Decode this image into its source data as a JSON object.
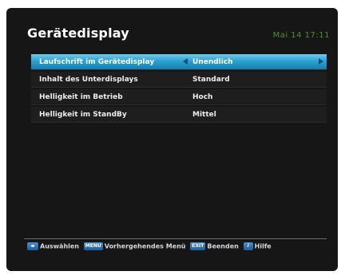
{
  "header": {
    "title": "Gerätedisplay",
    "clock": "Mai 14 17:11"
  },
  "menu": {
    "items": [
      {
        "label": "Laufschrift im Gerätedisplay",
        "value": "Unendlich"
      },
      {
        "label": "Inhalt des Unterdisplays",
        "value": "Standard"
      },
      {
        "label": "Helligkeit im Betrieb",
        "value": "Hoch"
      },
      {
        "label": "Helligkeit im StandBy",
        "value": "Mittel"
      }
    ]
  },
  "footer": {
    "select_key": "◂▸",
    "select_label": "Auswählen",
    "menu_key": "MENU",
    "menu_label": "Vorhergehendes Menü",
    "exit_key": "EXIT",
    "exit_label": "Beenden",
    "help_key": "i",
    "help_label": "Hilfe"
  },
  "colors": {
    "selection": "#2aa2d3",
    "clock": "#4e8f2c",
    "background": "#161616"
  }
}
